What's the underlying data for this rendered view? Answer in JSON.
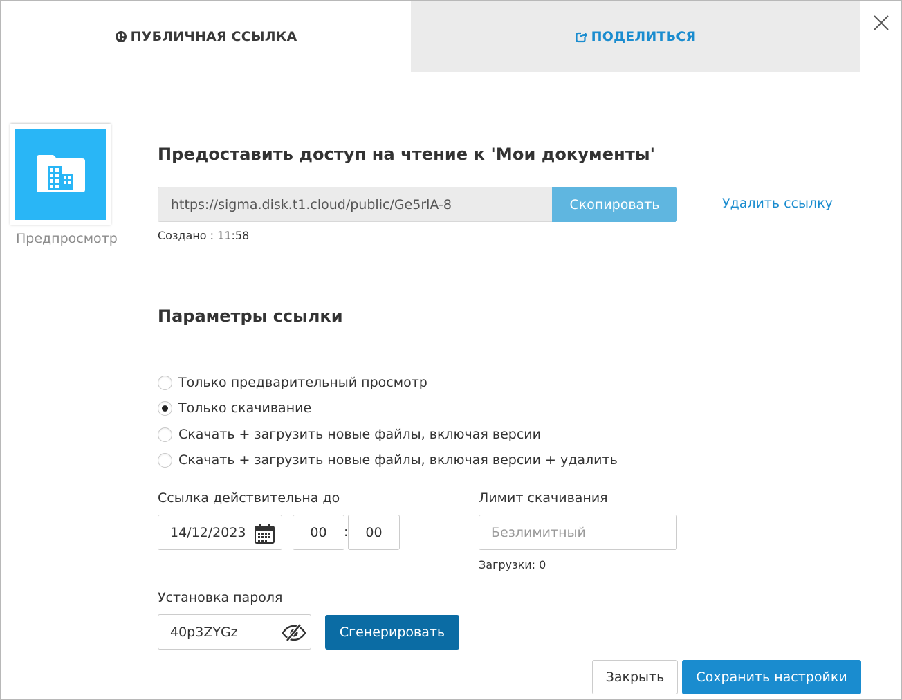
{
  "tabs": {
    "public_link": "ПУБЛИЧНАЯ ССЫЛКА",
    "share": "ПОДЕЛИТЬСЯ"
  },
  "preview": {
    "label": "Предпросмотр",
    "icon": "folder-building-icon",
    "color": "#29b6f6"
  },
  "access": {
    "heading": "Предоставить доступ на чтение к 'Мои документы'",
    "url": "https://sigma.disk.t1.cloud/public/Ge5rlA-8",
    "copy_label": "Скопировать",
    "delete_label": "Удалить ссылку",
    "created": "Создано : 11:58"
  },
  "params": {
    "title": "Параметры ссылки",
    "options": [
      {
        "label": "Только предварительный просмотр",
        "checked": false
      },
      {
        "label": "Только скачивание",
        "checked": true
      },
      {
        "label": "Скачать + загрузить новые файлы, включая версии",
        "checked": false
      },
      {
        "label": "Скачать + загрузить новые файлы, включая версии + удалить",
        "checked": false
      }
    ],
    "valid_until_label": "Ссылка действительна до",
    "date_value": "14/12/2023",
    "hours_value": "00",
    "minutes_value": "00",
    "time_separator": ":",
    "limit_label": "Лимит скачивания",
    "limit_placeholder": "Безлимитный",
    "downloads": "Загрузки: 0",
    "password_label": "Установка пароля",
    "password_value": "40p3ZYGz",
    "generate_label": "Сгенерировать"
  },
  "footer": {
    "close_label": "Закрыть",
    "save_label": "Сохранить настройки"
  },
  "colors": {
    "accent": "#1a8ccf",
    "copy_button": "#5fb6e0",
    "generate_button": "#0b6ca4",
    "inactive_tab": "#ebebeb"
  }
}
